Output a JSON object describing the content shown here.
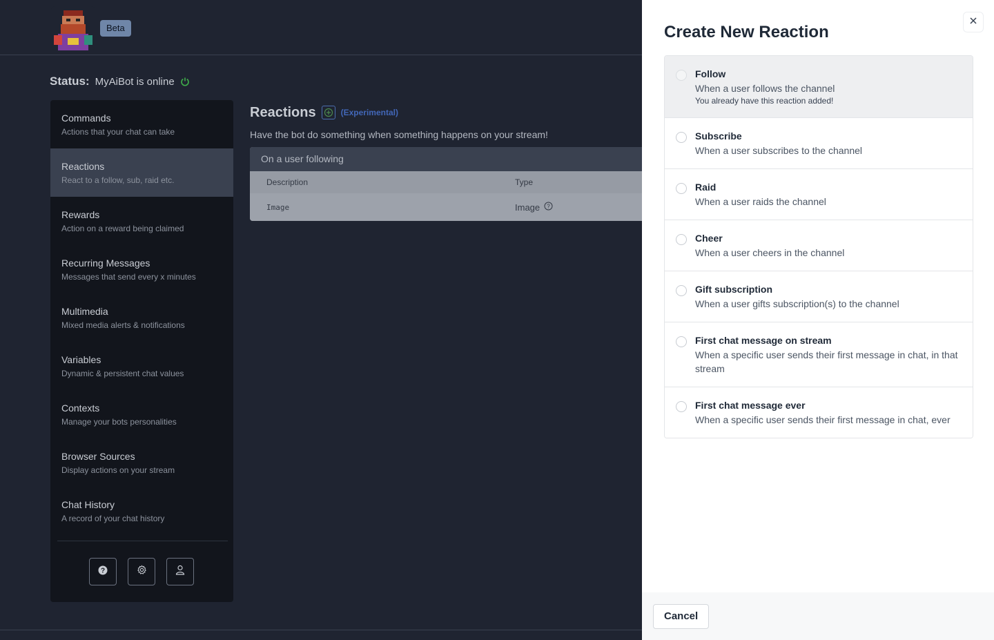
{
  "header": {
    "beta_badge": "Beta"
  },
  "status": {
    "label": "Status:",
    "text": "MyAiBot is online"
  },
  "sidebar": {
    "items": [
      {
        "title": "Commands",
        "desc": "Actions that your chat can take"
      },
      {
        "title": "Reactions",
        "desc": "React to a follow, sub, raid etc."
      },
      {
        "title": "Rewards",
        "desc": "Action on a reward being claimed"
      },
      {
        "title": "Recurring Messages",
        "desc": "Messages that send every x minutes"
      },
      {
        "title": "Multimedia",
        "desc": "Mixed media alerts & notifications"
      },
      {
        "title": "Variables",
        "desc": "Dynamic & persistent chat values"
      },
      {
        "title": "Contexts",
        "desc": "Manage your bots personalities"
      },
      {
        "title": "Browser Sources",
        "desc": "Display actions on your stream"
      },
      {
        "title": "Chat History",
        "desc": "A record of your chat history"
      }
    ],
    "active_index": 1,
    "bottom_icons": [
      "help-icon",
      "gear-icon",
      "user-icon"
    ]
  },
  "main": {
    "title": "Reactions",
    "badge": "(Experimental)",
    "description": "Have the bot do something when something happens on your stream!",
    "card": {
      "header": "On a user following",
      "columns": [
        "Description",
        "Type"
      ],
      "row": {
        "description": "Image",
        "type": "Image"
      }
    }
  },
  "drawer": {
    "title": "Create New Reaction",
    "options": [
      {
        "title": "Follow",
        "desc": "When a user follows the channel",
        "note": "You already have this reaction added!",
        "disabled": true
      },
      {
        "title": "Subscribe",
        "desc": "When a user subscribes to the channel"
      },
      {
        "title": "Raid",
        "desc": "When a user raids the channel"
      },
      {
        "title": "Cheer",
        "desc": "When a user cheers in the channel"
      },
      {
        "title": "Gift subscription",
        "desc": "When a user gifts subscription(s) to the channel"
      },
      {
        "title": "First chat message on stream",
        "desc": "When a specific user sends their first message in chat, in that stream"
      },
      {
        "title": "First chat message ever",
        "desc": "When a specific user sends their first message in chat, ever"
      }
    ],
    "cancel_label": "Cancel"
  },
  "colors": {
    "status_online": "#3fae4a",
    "experimental_accent": "#4267b8",
    "drawer_bg": "#ffffff"
  }
}
